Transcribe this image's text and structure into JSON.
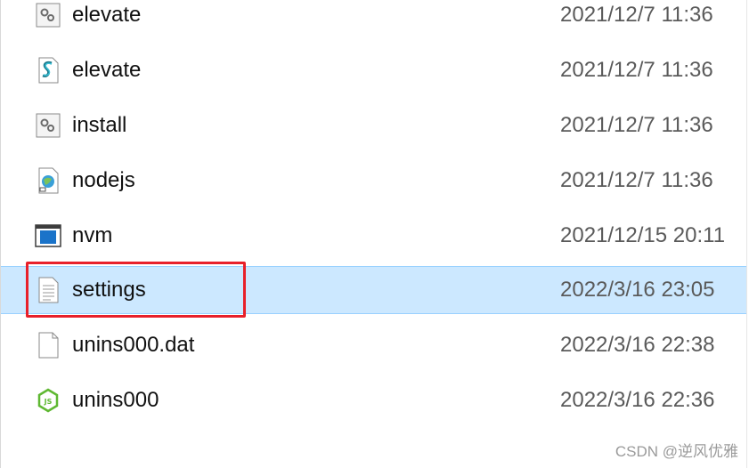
{
  "files": [
    {
      "name": "elevate",
      "date": "2021/12/7 11:36",
      "icon": "gear-file-icon",
      "selected": false
    },
    {
      "name": "elevate",
      "date": "2021/12/7 11:36",
      "icon": "script-file-icon",
      "selected": false
    },
    {
      "name": "install",
      "date": "2021/12/7 11:36",
      "icon": "gear-file-icon",
      "selected": false
    },
    {
      "name": "nodejs",
      "date": "2021/12/7 11:36",
      "icon": "shortcut-file-icon",
      "selected": false
    },
    {
      "name": "nvm",
      "date": "2021/12/15 20:11",
      "icon": "application-icon",
      "selected": false
    },
    {
      "name": "settings",
      "date": "2022/3/16 23:05",
      "icon": "text-file-icon",
      "selected": true
    },
    {
      "name": "unins000.dat",
      "date": "2022/3/16 22:38",
      "icon": "blank-file-icon",
      "selected": false
    },
    {
      "name": "unins000",
      "date": "2022/3/16 22:36",
      "icon": "nodejs-icon",
      "selected": false
    }
  ],
  "highlight_color": "#e8202a",
  "selection_color": "#cce8ff",
  "watermark": "CSDN @逆风优雅"
}
